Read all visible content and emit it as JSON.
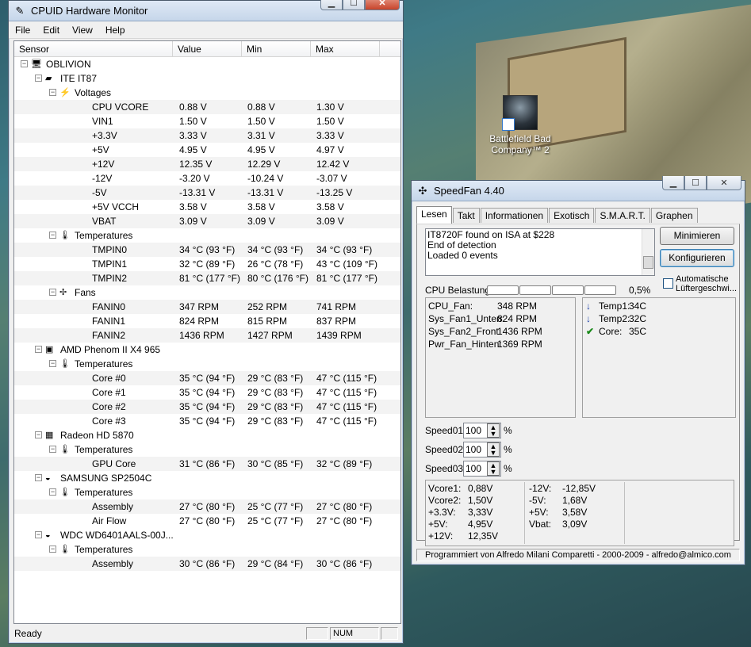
{
  "desktop": {
    "icon_label": "Battlefield Bad Company™ 2"
  },
  "hwmonitor": {
    "title": "CPUID Hardware Monitor",
    "menu": [
      "File",
      "Edit",
      "View",
      "Help"
    ],
    "columns": [
      "Sensor",
      "Value",
      "Min",
      "Max"
    ],
    "status": {
      "left": "Ready",
      "num": "NUM"
    },
    "tree": [
      {
        "level": 0,
        "icon": "computer-icon",
        "label": "OBLIVION"
      },
      {
        "level": 1,
        "icon": "chip-icon",
        "label": "ITE IT87"
      },
      {
        "level": 2,
        "icon": "voltage-icon",
        "label": "Voltages"
      },
      {
        "level": 3,
        "label": "CPU VCORE",
        "value": "0.88 V",
        "min": "0.88 V",
        "max": "1.30 V"
      },
      {
        "level": 3,
        "label": "VIN1",
        "value": "1.50 V",
        "min": "1.50 V",
        "max": "1.50 V"
      },
      {
        "level": 3,
        "label": "+3.3V",
        "value": "3.33 V",
        "min": "3.31 V",
        "max": "3.33 V"
      },
      {
        "level": 3,
        "label": "+5V",
        "value": "4.95 V",
        "min": "4.95 V",
        "max": "4.97 V"
      },
      {
        "level": 3,
        "label": "+12V",
        "value": "12.35 V",
        "min": "12.29 V",
        "max": "12.42 V"
      },
      {
        "level": 3,
        "label": "-12V",
        "value": "-3.20 V",
        "min": "-10.24 V",
        "max": "-3.07 V"
      },
      {
        "level": 3,
        "label": "-5V",
        "value": "-13.31 V",
        "min": "-13.31 V",
        "max": "-13.25 V"
      },
      {
        "level": 3,
        "label": "+5V VCCH",
        "value": "3.58 V",
        "min": "3.58 V",
        "max": "3.58 V"
      },
      {
        "level": 3,
        "label": "VBAT",
        "value": "3.09 V",
        "min": "3.09 V",
        "max": "3.09 V"
      },
      {
        "level": 2,
        "icon": "thermometer-icon",
        "label": "Temperatures"
      },
      {
        "level": 3,
        "label": "TMPIN0",
        "value": "34 °C  (93 °F)",
        "min": "34 °C  (93 °F)",
        "max": "34 °C  (93 °F)"
      },
      {
        "level": 3,
        "label": "TMPIN1",
        "value": "32 °C  (89 °F)",
        "min": "26 °C  (78 °F)",
        "max": "43 °C  (109 °F)"
      },
      {
        "level": 3,
        "label": "TMPIN2",
        "value": "81 °C  (177 °F)",
        "min": "80 °C  (176 °F)",
        "max": "81 °C  (177 °F)"
      },
      {
        "level": 2,
        "icon": "fan-icon",
        "label": "Fans"
      },
      {
        "level": 3,
        "label": "FANIN0",
        "value": "347 RPM",
        "min": "252 RPM",
        "max": "741 RPM"
      },
      {
        "level": 3,
        "label": "FANIN1",
        "value": "824 RPM",
        "min": "815 RPM",
        "max": "837 RPM"
      },
      {
        "level": 3,
        "label": "FANIN2",
        "value": "1436 RPM",
        "min": "1427 RPM",
        "max": "1439 RPM"
      },
      {
        "level": 1,
        "icon": "cpu-icon",
        "label": "AMD Phenom II X4 965"
      },
      {
        "level": 2,
        "icon": "thermometer-icon",
        "label": "Temperatures"
      },
      {
        "level": 3,
        "label": "Core #0",
        "value": "35 °C  (94 °F)",
        "min": "29 °C  (83 °F)",
        "max": "47 °C  (115 °F)"
      },
      {
        "level": 3,
        "label": "Core #1",
        "value": "35 °C  (94 °F)",
        "min": "29 °C  (83 °F)",
        "max": "47 °C  (115 °F)"
      },
      {
        "level": 3,
        "label": "Core #2",
        "value": "35 °C  (94 °F)",
        "min": "29 °C  (83 °F)",
        "max": "47 °C  (115 °F)"
      },
      {
        "level": 3,
        "label": "Core #3",
        "value": "35 °C  (94 °F)",
        "min": "29 °C  (83 °F)",
        "max": "47 °C  (115 °F)"
      },
      {
        "level": 1,
        "icon": "gpu-icon",
        "label": "Radeon HD 5870"
      },
      {
        "level": 2,
        "icon": "thermometer-icon",
        "label": "Temperatures"
      },
      {
        "level": 3,
        "label": "GPU Core",
        "value": "31 °C  (86 °F)",
        "min": "30 °C  (85 °F)",
        "max": "32 °C  (89 °F)"
      },
      {
        "level": 1,
        "icon": "drive-icon",
        "label": "SAMSUNG SP2504C"
      },
      {
        "level": 2,
        "icon": "thermometer-icon",
        "label": "Temperatures"
      },
      {
        "level": 3,
        "label": "Assembly",
        "value": "27 °C  (80 °F)",
        "min": "25 °C  (77 °F)",
        "max": "27 °C  (80 °F)"
      },
      {
        "level": 3,
        "label": "Air Flow",
        "value": "27 °C  (80 °F)",
        "min": "25 °C  (77 °F)",
        "max": "27 °C  (80 °F)"
      },
      {
        "level": 1,
        "icon": "drive-icon",
        "label": "WDC WD6401AALS-00J..."
      },
      {
        "level": 2,
        "icon": "thermometer-icon",
        "label": "Temperatures"
      },
      {
        "level": 3,
        "label": "Assembly",
        "value": "30 °C  (86 °F)",
        "min": "29 °C  (84 °F)",
        "max": "30 °C  (86 °F)"
      }
    ]
  },
  "speedfan": {
    "title": "SpeedFan 4.40",
    "tabs": [
      "Lesen",
      "Takt",
      "Informationen",
      "Exotisch",
      "S.M.A.R.T.",
      "Graphen"
    ],
    "log": [
      "IT8720F found on ISA at $228",
      "End of detection",
      "Loaded 0 events"
    ],
    "buttons": {
      "minimize": "Minimieren",
      "configure": "Konfigurieren"
    },
    "cpu_label": "CPU Belastung",
    "cpu_percent": "0,5%",
    "auto_fan_label": "Automatische Lüftergeschwi...",
    "fans": [
      {
        "name": "CPU_Fan:",
        "value": "348 RPM"
      },
      {
        "name": "Sys_Fan1_Unten:",
        "value": "824 RPM"
      },
      {
        "name": "Sys_Fan2_Front:",
        "value": "1436 RPM"
      },
      {
        "name": "Pwr_Fan_Hinten:",
        "value": "1369 RPM"
      }
    ],
    "temps": [
      {
        "name": "Temp1:",
        "value": "34C",
        "icon": "arrow-down-icon"
      },
      {
        "name": "Temp2:",
        "value": "32C",
        "icon": "arrow-down-icon"
      },
      {
        "name": "Core:",
        "value": "35C",
        "icon": "check-icon"
      }
    ],
    "speeds": [
      {
        "label": "Speed01:",
        "value": "100",
        "unit": "%"
      },
      {
        "label": "Speed02:",
        "value": "100",
        "unit": "%"
      },
      {
        "label": "Speed03:",
        "value": "100",
        "unit": "%"
      }
    ],
    "voltages_left": [
      {
        "name": "Vcore1:",
        "value": "0,88V"
      },
      {
        "name": "Vcore2:",
        "value": "1,50V"
      },
      {
        "name": "+3.3V:",
        "value": "3,33V"
      },
      {
        "name": "+5V:",
        "value": "4,95V"
      },
      {
        "name": "+12V:",
        "value": "12,35V"
      }
    ],
    "voltages_right": [
      {
        "name": "-12V:",
        "value": "-12,85V"
      },
      {
        "name": "-5V:",
        "value": "1,68V"
      },
      {
        "name": "+5V:",
        "value": "3,58V"
      },
      {
        "name": "Vbat:",
        "value": "3,09V"
      }
    ],
    "footer": "Programmiert von Alfredo Milani Comparetti - 2000-2009 - alfredo@almico.com"
  }
}
